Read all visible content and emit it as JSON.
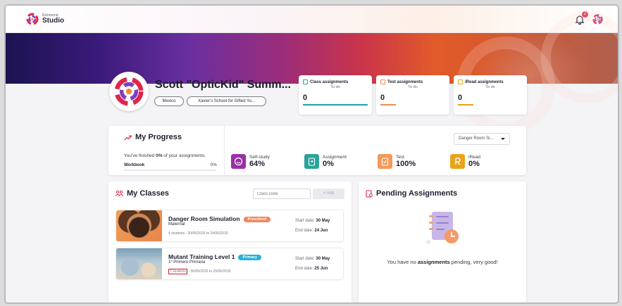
{
  "header": {
    "logo_small": "Richmond",
    "logo_big": "Studio",
    "notification_count": "2"
  },
  "profile": {
    "name": "Scott \"OpticKid\" Summ...",
    "country": "Mexico",
    "school": "Xavier's School for Gifted Yo..."
  },
  "stat_cards": [
    {
      "title": "Class assignments",
      "sub": "To do",
      "value": "0",
      "color": "#21a3a8"
    },
    {
      "title": "Test assignments",
      "sub": "To do",
      "value": "0",
      "color": "#f28a4a"
    },
    {
      "title": "iRead assignments",
      "sub": "To do",
      "value": "0",
      "color": "#e8a21a"
    }
  ],
  "progress": {
    "title": "My Progress",
    "finished_pre": "You've finished ",
    "finished_pct": "0%",
    "finished_post": " of your assignments.",
    "workbook_label": "Workbook",
    "workbook_pct": "0%",
    "workbook_fraction": 0,
    "dropdown_value": "Danger Room Si...",
    "metrics": [
      {
        "label": "Self-study",
        "value": "64%",
        "color": "#9b2fa6",
        "icon": "smile-icon"
      },
      {
        "label": "Assignment",
        "value": "0%",
        "color": "#2aa49a",
        "icon": "clipboard-icon"
      },
      {
        "label": "Test",
        "value": "100%",
        "color": "#f39a5a",
        "icon": "check-doc-icon"
      },
      {
        "label": "iRead",
        "value": "0%",
        "color": "#e9a41c",
        "icon": "iread-icon"
      }
    ]
  },
  "classes": {
    "title": "My Classes",
    "code_placeholder": "Class code",
    "add_label": "+ Add",
    "items": [
      {
        "name": "Danger Room Simulation",
        "tag": "Preschool",
        "tag_color": "#f2865a",
        "level": "Maternal",
        "meta_students": "4 students",
        "meta_dates": " - 30/05/2025 to 24/06/2030",
        "start_label": "Start date:",
        "start": "30 May",
        "end_label": "End date:",
        "end": "24 Jun"
      },
      {
        "name": "Mutant Training Level 1",
        "tag": "Primary",
        "tag_color": "#2ab0d8",
        "level": "1º Primero Primaria",
        "meta_students": "7 students",
        "meta_dates": " - 30/05/2025 to 25/06/2035",
        "start_label": "Start date:",
        "start": "30 May",
        "end_label": "End date:",
        "end": "25 Jun"
      }
    ]
  },
  "pending": {
    "title": "Pending Assignments",
    "msg_pre": "You have no ",
    "msg_bold": "assignments",
    "msg_post": " pending, very good!"
  }
}
